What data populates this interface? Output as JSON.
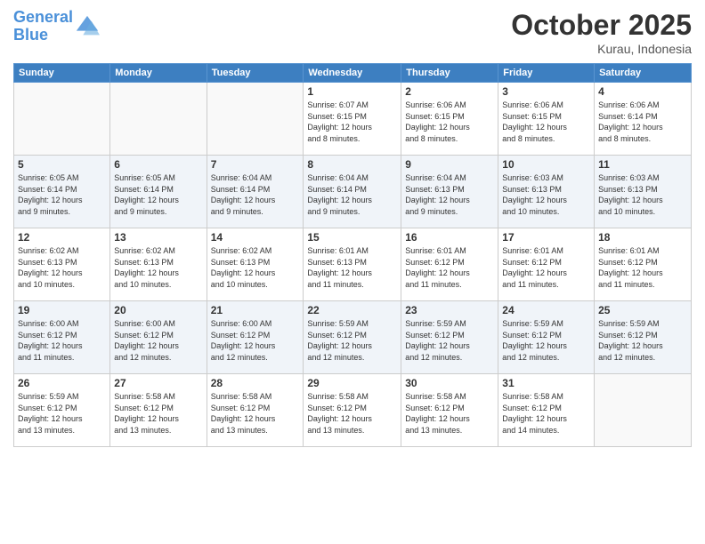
{
  "logo": {
    "line1": "General",
    "line2": "Blue"
  },
  "header": {
    "month": "October 2025",
    "location": "Kurau, Indonesia"
  },
  "weekdays": [
    "Sunday",
    "Monday",
    "Tuesday",
    "Wednesday",
    "Thursday",
    "Friday",
    "Saturday"
  ],
  "weeks": [
    [
      {
        "day": "",
        "info": ""
      },
      {
        "day": "",
        "info": ""
      },
      {
        "day": "",
        "info": ""
      },
      {
        "day": "1",
        "info": "Sunrise: 6:07 AM\nSunset: 6:15 PM\nDaylight: 12 hours\nand 8 minutes."
      },
      {
        "day": "2",
        "info": "Sunrise: 6:06 AM\nSunset: 6:15 PM\nDaylight: 12 hours\nand 8 minutes."
      },
      {
        "day": "3",
        "info": "Sunrise: 6:06 AM\nSunset: 6:15 PM\nDaylight: 12 hours\nand 8 minutes."
      },
      {
        "day": "4",
        "info": "Sunrise: 6:06 AM\nSunset: 6:14 PM\nDaylight: 12 hours\nand 8 minutes."
      }
    ],
    [
      {
        "day": "5",
        "info": "Sunrise: 6:05 AM\nSunset: 6:14 PM\nDaylight: 12 hours\nand 9 minutes."
      },
      {
        "day": "6",
        "info": "Sunrise: 6:05 AM\nSunset: 6:14 PM\nDaylight: 12 hours\nand 9 minutes."
      },
      {
        "day": "7",
        "info": "Sunrise: 6:04 AM\nSunset: 6:14 PM\nDaylight: 12 hours\nand 9 minutes."
      },
      {
        "day": "8",
        "info": "Sunrise: 6:04 AM\nSunset: 6:14 PM\nDaylight: 12 hours\nand 9 minutes."
      },
      {
        "day": "9",
        "info": "Sunrise: 6:04 AM\nSunset: 6:13 PM\nDaylight: 12 hours\nand 9 minutes."
      },
      {
        "day": "10",
        "info": "Sunrise: 6:03 AM\nSunset: 6:13 PM\nDaylight: 12 hours\nand 10 minutes."
      },
      {
        "day": "11",
        "info": "Sunrise: 6:03 AM\nSunset: 6:13 PM\nDaylight: 12 hours\nand 10 minutes."
      }
    ],
    [
      {
        "day": "12",
        "info": "Sunrise: 6:02 AM\nSunset: 6:13 PM\nDaylight: 12 hours\nand 10 minutes."
      },
      {
        "day": "13",
        "info": "Sunrise: 6:02 AM\nSunset: 6:13 PM\nDaylight: 12 hours\nand 10 minutes."
      },
      {
        "day": "14",
        "info": "Sunrise: 6:02 AM\nSunset: 6:13 PM\nDaylight: 12 hours\nand 10 minutes."
      },
      {
        "day": "15",
        "info": "Sunrise: 6:01 AM\nSunset: 6:13 PM\nDaylight: 12 hours\nand 11 minutes."
      },
      {
        "day": "16",
        "info": "Sunrise: 6:01 AM\nSunset: 6:12 PM\nDaylight: 12 hours\nand 11 minutes."
      },
      {
        "day": "17",
        "info": "Sunrise: 6:01 AM\nSunset: 6:12 PM\nDaylight: 12 hours\nand 11 minutes."
      },
      {
        "day": "18",
        "info": "Sunrise: 6:01 AM\nSunset: 6:12 PM\nDaylight: 12 hours\nand 11 minutes."
      }
    ],
    [
      {
        "day": "19",
        "info": "Sunrise: 6:00 AM\nSunset: 6:12 PM\nDaylight: 12 hours\nand 11 minutes."
      },
      {
        "day": "20",
        "info": "Sunrise: 6:00 AM\nSunset: 6:12 PM\nDaylight: 12 hours\nand 12 minutes."
      },
      {
        "day": "21",
        "info": "Sunrise: 6:00 AM\nSunset: 6:12 PM\nDaylight: 12 hours\nand 12 minutes."
      },
      {
        "day": "22",
        "info": "Sunrise: 5:59 AM\nSunset: 6:12 PM\nDaylight: 12 hours\nand 12 minutes."
      },
      {
        "day": "23",
        "info": "Sunrise: 5:59 AM\nSunset: 6:12 PM\nDaylight: 12 hours\nand 12 minutes."
      },
      {
        "day": "24",
        "info": "Sunrise: 5:59 AM\nSunset: 6:12 PM\nDaylight: 12 hours\nand 12 minutes."
      },
      {
        "day": "25",
        "info": "Sunrise: 5:59 AM\nSunset: 6:12 PM\nDaylight: 12 hours\nand 12 minutes."
      }
    ],
    [
      {
        "day": "26",
        "info": "Sunrise: 5:59 AM\nSunset: 6:12 PM\nDaylight: 12 hours\nand 13 minutes."
      },
      {
        "day": "27",
        "info": "Sunrise: 5:58 AM\nSunset: 6:12 PM\nDaylight: 12 hours\nand 13 minutes."
      },
      {
        "day": "28",
        "info": "Sunrise: 5:58 AM\nSunset: 6:12 PM\nDaylight: 12 hours\nand 13 minutes."
      },
      {
        "day": "29",
        "info": "Sunrise: 5:58 AM\nSunset: 6:12 PM\nDaylight: 12 hours\nand 13 minutes."
      },
      {
        "day": "30",
        "info": "Sunrise: 5:58 AM\nSunset: 6:12 PM\nDaylight: 12 hours\nand 13 minutes."
      },
      {
        "day": "31",
        "info": "Sunrise: 5:58 AM\nSunset: 6:12 PM\nDaylight: 12 hours\nand 14 minutes."
      },
      {
        "day": "",
        "info": ""
      }
    ]
  ]
}
